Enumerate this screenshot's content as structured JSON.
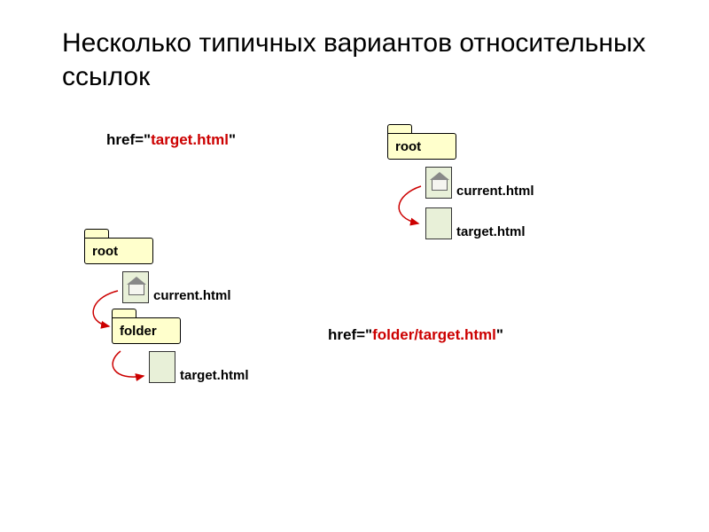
{
  "title": "Несколько типичных вариантов относительных ссылок",
  "example1": {
    "href_prefix": "href=\"",
    "href_value": "target.html",
    "href_suffix": "\"",
    "root_label": "root",
    "current_label": "current.html",
    "target_label": "target.html"
  },
  "example2": {
    "href_prefix": "href=\"",
    "href_value": "folder/target.html",
    "href_suffix": "\"",
    "root_label": "root",
    "folder_label": "folder",
    "current_label": "current.html",
    "target_label": "target.html"
  }
}
